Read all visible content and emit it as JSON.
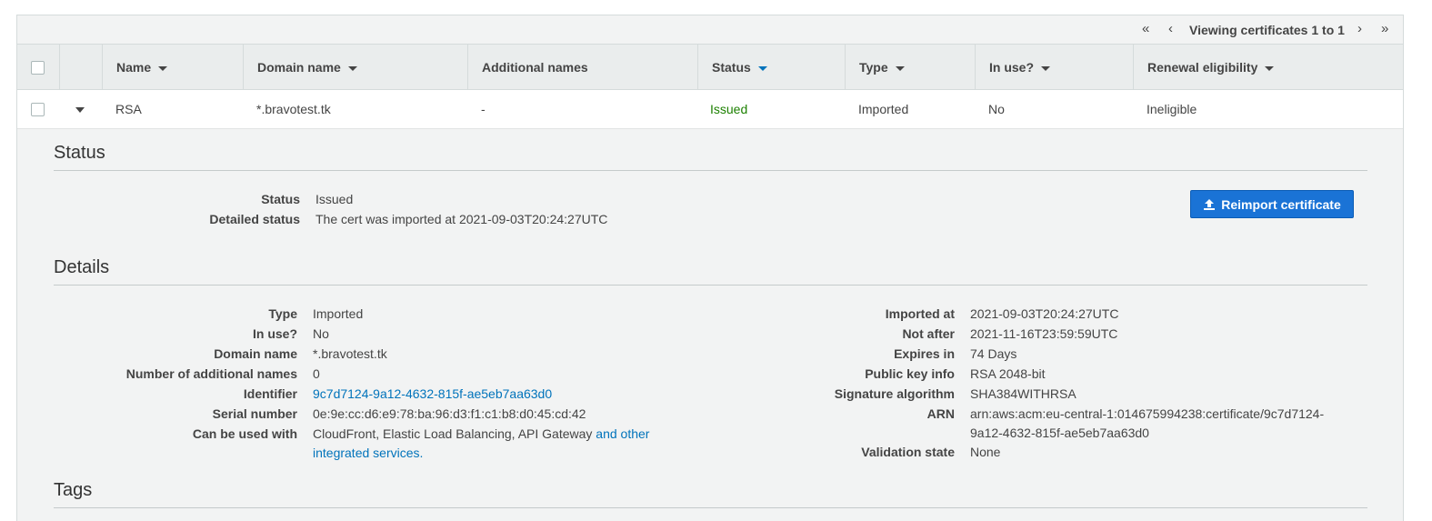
{
  "pager": {
    "first_icon": "«",
    "prev_icon": "‹",
    "text": "Viewing certificates 1 to 1",
    "next_icon": "›",
    "last_icon": "»"
  },
  "table": {
    "columns": [
      "Name",
      "Domain name",
      "Additional names",
      "Status",
      "Type",
      "In use?",
      "Renewal eligibility"
    ],
    "rows": [
      {
        "name": "RSA",
        "domain_name": "*.bravotest.tk",
        "additional_names": "-",
        "status": "Issued",
        "type": "Imported",
        "in_use": "No",
        "renewal_eligibility": "Ineligible"
      }
    ]
  },
  "status_section": {
    "title": "Status",
    "status_label": "Status",
    "status_value": "Issued",
    "detailed_label": "Detailed status",
    "detailed_value": "The cert was imported at 2021-09-03T20:24:27UTC",
    "reimport_button": "Reimport certificate"
  },
  "details_section": {
    "title": "Details",
    "left": [
      {
        "label": "Type",
        "value": "Imported"
      },
      {
        "label": "In use?",
        "value": "No"
      },
      {
        "label": "Domain name",
        "value": "*.bravotest.tk"
      },
      {
        "label": "Number of additional names",
        "value": "0"
      },
      {
        "label": "Identifier",
        "value": "9c7d7124-9a12-4632-815f-ae5eb7aa63d0"
      },
      {
        "label": "Serial number",
        "value": "0e:9e:cc:d6:e9:78:ba:96:d3:f1:c1:b8:d0:45:cd:42"
      },
      {
        "label": "Can be used with",
        "value": "CloudFront, Elastic Load Balancing, API Gateway",
        "link_1": "and other",
        "link_2": "integrated services."
      }
    ],
    "right": [
      {
        "label": "Imported at",
        "value": "2021-09-03T20:24:27UTC"
      },
      {
        "label": "Not after",
        "value": "2021-11-16T23:59:59UTC"
      },
      {
        "label": "Expires in",
        "value": "74 Days"
      },
      {
        "label": "Public key info",
        "value": "RSA 2048-bit"
      },
      {
        "label": "Signature algorithm",
        "value": "SHA384WITHRSA"
      },
      {
        "label": "ARN",
        "value_1": "arn:aws:acm:eu-central-1:014675994238:certificate/9c7d7124-",
        "value_2": "9a12-4632-815f-ae5eb7aa63d0"
      },
      {
        "label": "Validation state",
        "value": "None"
      }
    ]
  },
  "tags_section": {
    "title": "Tags"
  },
  "colors": {
    "issued": "#1d8102",
    "link": "#0073bb",
    "primary_button": "#1a73d6"
  }
}
